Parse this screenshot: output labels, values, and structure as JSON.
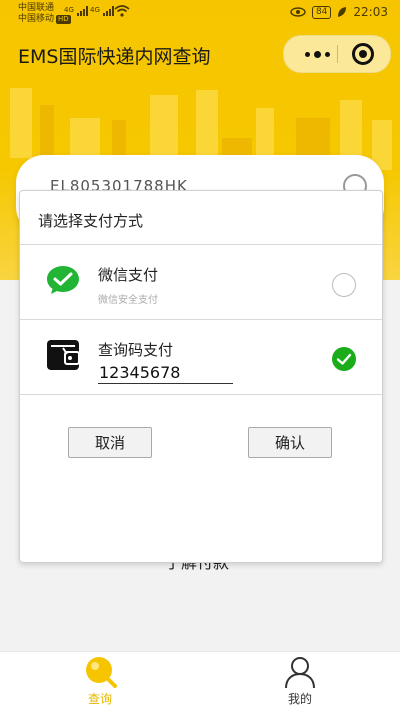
{
  "status_bar": {
    "carrier1": "中国联通",
    "carrier2": "中国移动",
    "hd_badge": "HD",
    "net1": "4G",
    "net2": "4G",
    "battery": "84",
    "time": "22:03"
  },
  "header": {
    "title": "EMS国际快递内网查询"
  },
  "search": {
    "tracking_number": "EL805301788HK"
  },
  "background_text": "了解付款",
  "modal": {
    "title": "请选择支付方式",
    "options": [
      {
        "title": "微信支付",
        "subtitle": "微信安全支付",
        "selected": false,
        "icon": "wechat-pay-icon"
      },
      {
        "title": "查询码支付",
        "subtitle": "",
        "selected": true,
        "icon": "wallet-icon",
        "input_value": "12345678"
      }
    ],
    "cancel_label": "取消",
    "confirm_label": "确认"
  },
  "tabbar": {
    "items": [
      {
        "label": "查询",
        "icon": "query-icon",
        "active": true
      },
      {
        "label": "我的",
        "icon": "user-icon",
        "active": false
      }
    ]
  },
  "colors": {
    "brand_yellow": "#f6c500",
    "check_green": "#1aad19",
    "tab_active": "#e6b800"
  }
}
